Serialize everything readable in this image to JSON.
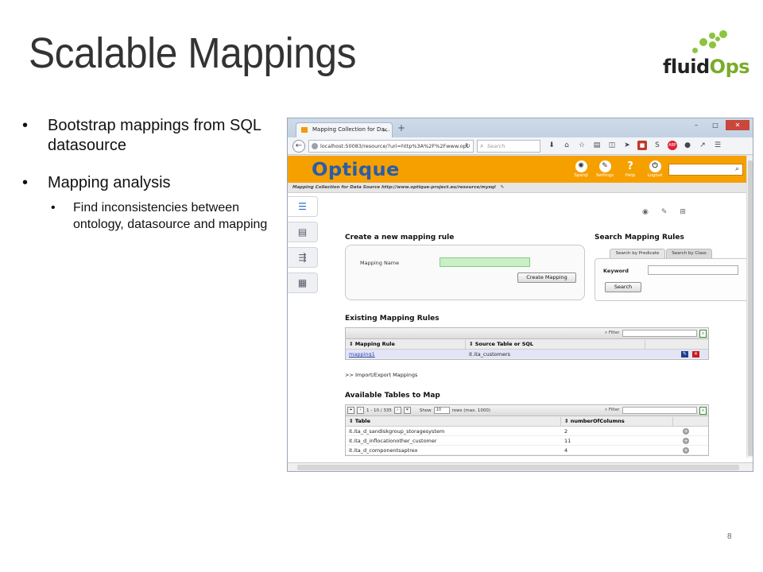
{
  "slide": {
    "title": "Scalable Mappings",
    "logo_prefix": "fluid",
    "logo_suffix": "Ops",
    "bullet1": "Bootstrap mappings from SQL datasource",
    "bullet2": "Mapping analysis",
    "sub_bullet": "Find inconsistencies between ontology, datasource and mapping",
    "page_number": "8",
    "logo_color": "#8cc43f"
  },
  "browser": {
    "tab_title": "Mapping Collection for Da...",
    "tab_close": "×",
    "new_tab": "+",
    "url": "localhost:50083/resource/?uri=http%3A%2F%2Fwww.opt",
    "search_placeholder": "Search",
    "window_controls": [
      "–",
      "□",
      "✕"
    ],
    "toolbar_icons": [
      "download-icon",
      "home-icon",
      "star-icon",
      "clipboard-icon",
      "pocket-icon",
      "send-icon",
      "red-addon-icon",
      "s-addon-icon",
      "adblock-icon",
      "chat-icon",
      "share-icon",
      "menu-icon"
    ]
  },
  "app": {
    "brand": "Optique",
    "brand_color": "#f6a000",
    "top_buttons": [
      {
        "label": "Sparql",
        "icon": "sparql-icon"
      },
      {
        "label": "Settings",
        "icon": "wrench-icon"
      },
      {
        "label": "Help",
        "icon": "help-icon"
      },
      {
        "label": "Logout",
        "icon": "logout-icon"
      }
    ],
    "path": "Mapping Collection for Data Source http://www.optique-project.eu/resource/mysql",
    "create": {
      "heading": "Create a new mapping rule",
      "name_label": "Mapping Name",
      "name_value": "",
      "button": "Create Mapping"
    },
    "search": {
      "heading": "Search Mapping Rules",
      "tab_predicate": "Search by Predicate",
      "tab_class": "Search by Class",
      "keyword_label": "Keyword",
      "keyword_value": "",
      "button": "Search"
    },
    "existing": {
      "heading": "Existing Mapping Rules",
      "filter_label": "Filter",
      "columns": [
        "Mapping Rule",
        "Source Table or SQL"
      ],
      "rows": [
        {
          "rule": "mapping1",
          "source": "it.ita_customers"
        }
      ]
    },
    "import_link": ">> Import/Export Mappings",
    "tables": {
      "heading": "Available Tables to Map",
      "page_info": "1 - 10 / 335",
      "show_label": "Show",
      "show_value": "10",
      "rows_label": "rows (max. 1000)",
      "filter_label": "Filter",
      "columns": [
        "Table",
        "numberOfColumns"
      ],
      "rows": [
        {
          "table": "it.ita_d_sandiskgroup_storagesystem",
          "count": "2"
        },
        {
          "table": "it.ita_d_inflocationother_customer",
          "count": "11"
        },
        {
          "table": "it.ita_d_componentsaptrex",
          "count": "4"
        }
      ]
    }
  }
}
